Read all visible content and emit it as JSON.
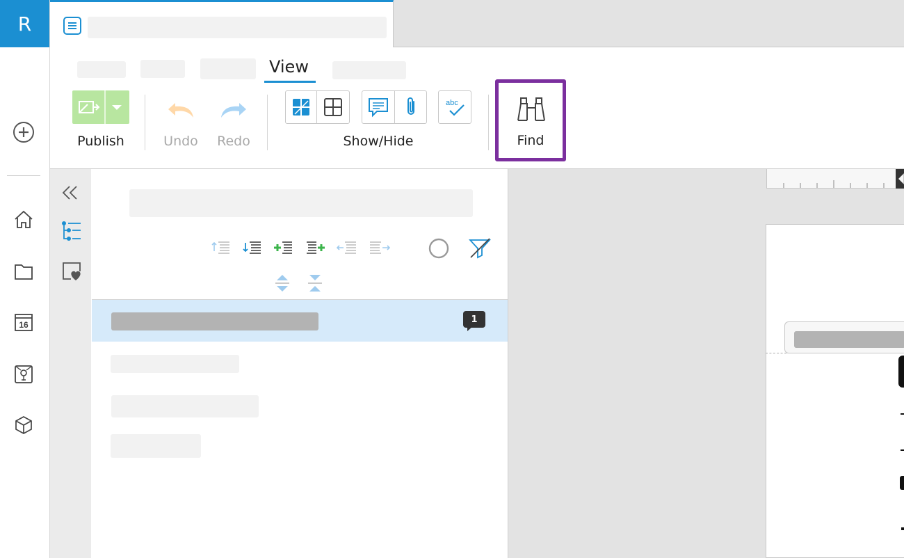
{
  "app": {
    "logo_letter": "R"
  },
  "rail": {
    "icons": [
      "plus-circle-icon",
      "home-icon",
      "folder-icon",
      "calendar-icon",
      "certificate-icon",
      "cube-icon"
    ],
    "calendar_day": "16"
  },
  "tab": {
    "icon": "document-icon"
  },
  "menu": {
    "active": "View"
  },
  "toolbar": {
    "publish_label": "Publish",
    "undo_label": "Undo",
    "redo_label": "Redo",
    "showhide_label": "Show/Hide",
    "find_label": "Find",
    "colors": {
      "publish_bg": "#b8e6a0",
      "accent": "#1b8fd2",
      "find_highlight": "#7b2f9e"
    }
  },
  "outline": {
    "selected_item_badge": "1"
  },
  "colors": {
    "brand": "#1b8fd2",
    "selection": "#d6eafa"
  }
}
